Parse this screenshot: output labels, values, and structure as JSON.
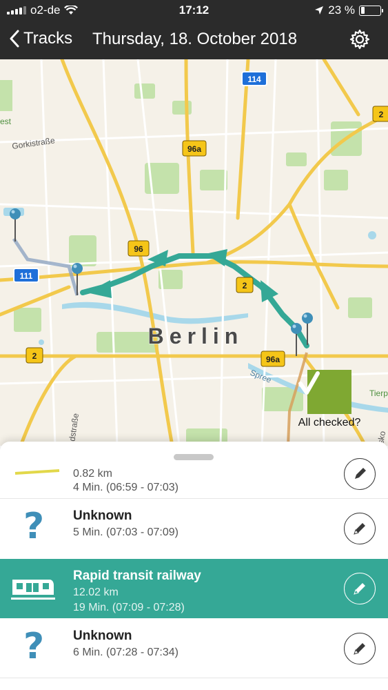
{
  "status_bar": {
    "carrier": "o2-de",
    "time": "17:12",
    "battery": "23 %",
    "battery_level": 0.23
  },
  "nav": {
    "back_label": "Tracks",
    "title": "Thursday, 18. October 2018",
    "settings_icon": "gear-icon"
  },
  "map": {
    "city_label": "Berlin",
    "street_labels": [
      "Gorkistraße",
      "Uhlandstraße",
      "Spree",
      "est",
      "Tierp",
      "sko"
    ],
    "road_badges": [
      "114",
      "2",
      "96a",
      "96",
      "111",
      "2",
      "2",
      "96a"
    ],
    "all_checked_label": "All checked?",
    "colors": {
      "route": "#35a896",
      "road_major": "#f2c94c",
      "badge_yellow": "#f5c518",
      "badge_blue": "#1e6fd9",
      "park": "#bfe0a6",
      "water": "#a8d8ea",
      "pin": "#3f8fb8",
      "check": "#7fa832"
    }
  },
  "timeline": {
    "partial_row": {
      "distance": "0.82 km",
      "duration": "4 Min. (06:59 - 07:03)"
    },
    "rows": [
      {
        "title": "Unknown",
        "line1": "5 Min. (07:03 - 07:09)",
        "icon": "question-mark-icon",
        "active": false
      },
      {
        "title": "Rapid transit railway",
        "line1": "12.02 km",
        "line2": "19 Min. (07:09 - 07:28)",
        "icon": "train-icon",
        "active": true
      },
      {
        "title": "Unknown",
        "line1": "6 Min. (07:28 - 07:34)",
        "icon": "question-mark-icon",
        "active": false
      }
    ]
  }
}
